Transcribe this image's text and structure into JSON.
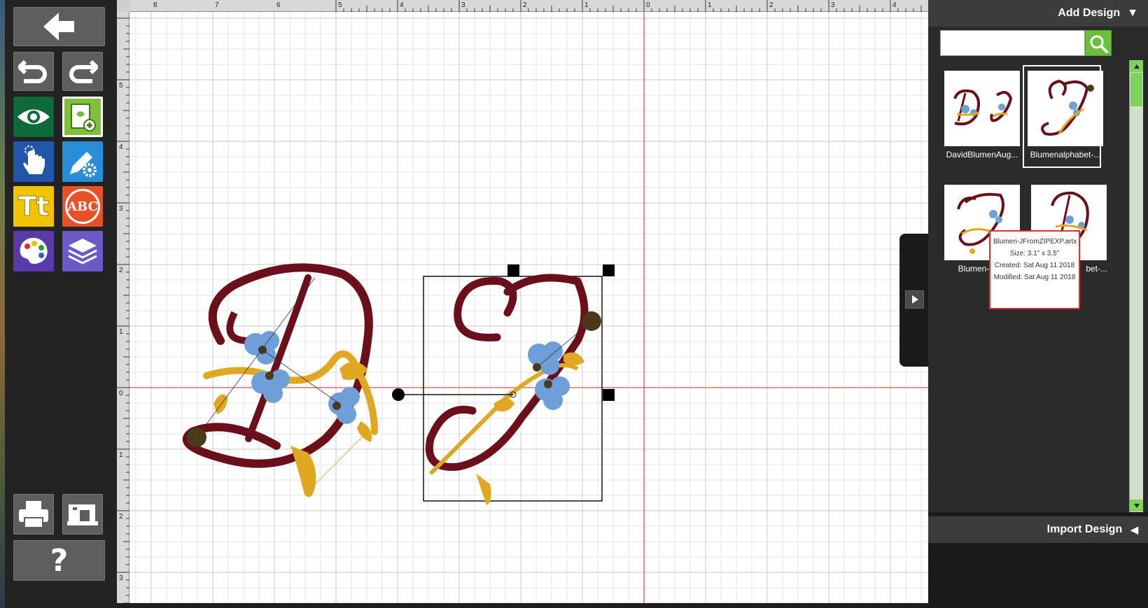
{
  "toolbar": {
    "back": "back-arrow-icon",
    "undo": "undo-icon",
    "redo": "redo-icon",
    "view": "eye-icon",
    "add_design": "add-design-icon",
    "select": "hand-select-icon",
    "edit": "edit-gear-icon",
    "text_label": "Tt",
    "monogram_label": "ABC",
    "palette": "palette-icon",
    "layers": "layers-icon",
    "print": "print-icon",
    "send_to_machine": "sewing-machine-icon",
    "help_label": "?"
  },
  "canvas": {
    "ruler_top_labels": [
      "8",
      "7",
      "6",
      "5",
      "4",
      "3",
      "2",
      "1",
      "0",
      "1",
      "2",
      "3",
      "4"
    ],
    "ruler_left_labels": [
      "5",
      "4",
      "3",
      "2",
      "1",
      "0",
      "1",
      "2",
      "3"
    ]
  },
  "panel": {
    "add_design_title": "Add Design",
    "add_design_arrow": "▼",
    "search_placeholder": "",
    "import_design_title": "Import Design",
    "import_design_arrow": "◀",
    "designs": [
      {
        "label": "DavidBlumenAug...",
        "selected": false
      },
      {
        "label": "Blumenalphabet-...",
        "selected": true
      },
      {
        "label": "Blumen-JFro",
        "selected": false
      },
      {
        "label": "bet-...",
        "selected": false
      }
    ]
  },
  "tooltip": {
    "filename": "Blumen-JFromZIPEXP.artx",
    "size": "Size: 3.1\" x 3.5\"",
    "created": "Created: Sat Aug 11 2018",
    "modified": "Modified: Sat Aug 11 2018"
  },
  "colors": {
    "thread_maroon": "#6b0f1a",
    "thread_gold": "#e0a820",
    "thread_blue": "#6e9fd8",
    "thread_brown": "#4a3a1a",
    "accent_green": "#6cbf3a",
    "axis_red": "#e02020"
  }
}
